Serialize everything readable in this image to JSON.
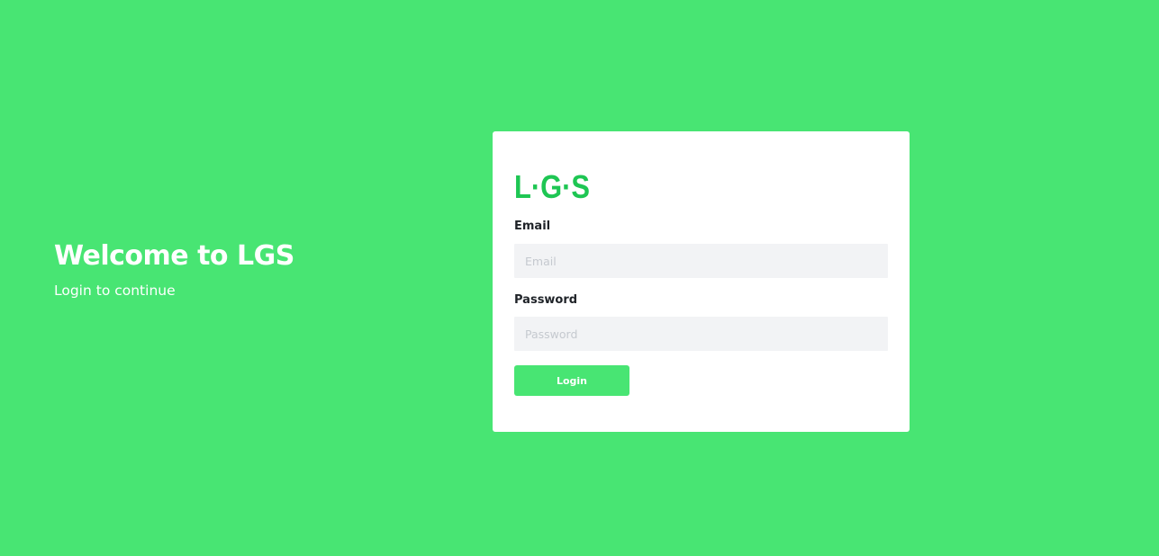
{
  "welcome": {
    "title": "Welcome to LGS",
    "subtitle": "Login to continue"
  },
  "logo": {
    "text": "L·G·S",
    "color": "#1ec653"
  },
  "form": {
    "email_label": "Email",
    "email_placeholder": "Email",
    "email_value": "",
    "password_label": "Password",
    "password_placeholder": "Password",
    "password_value": "",
    "login_label": "Login"
  },
  "colors": {
    "background": "#48e573",
    "button": "#48e573",
    "input_background": "#f2f3f5"
  }
}
